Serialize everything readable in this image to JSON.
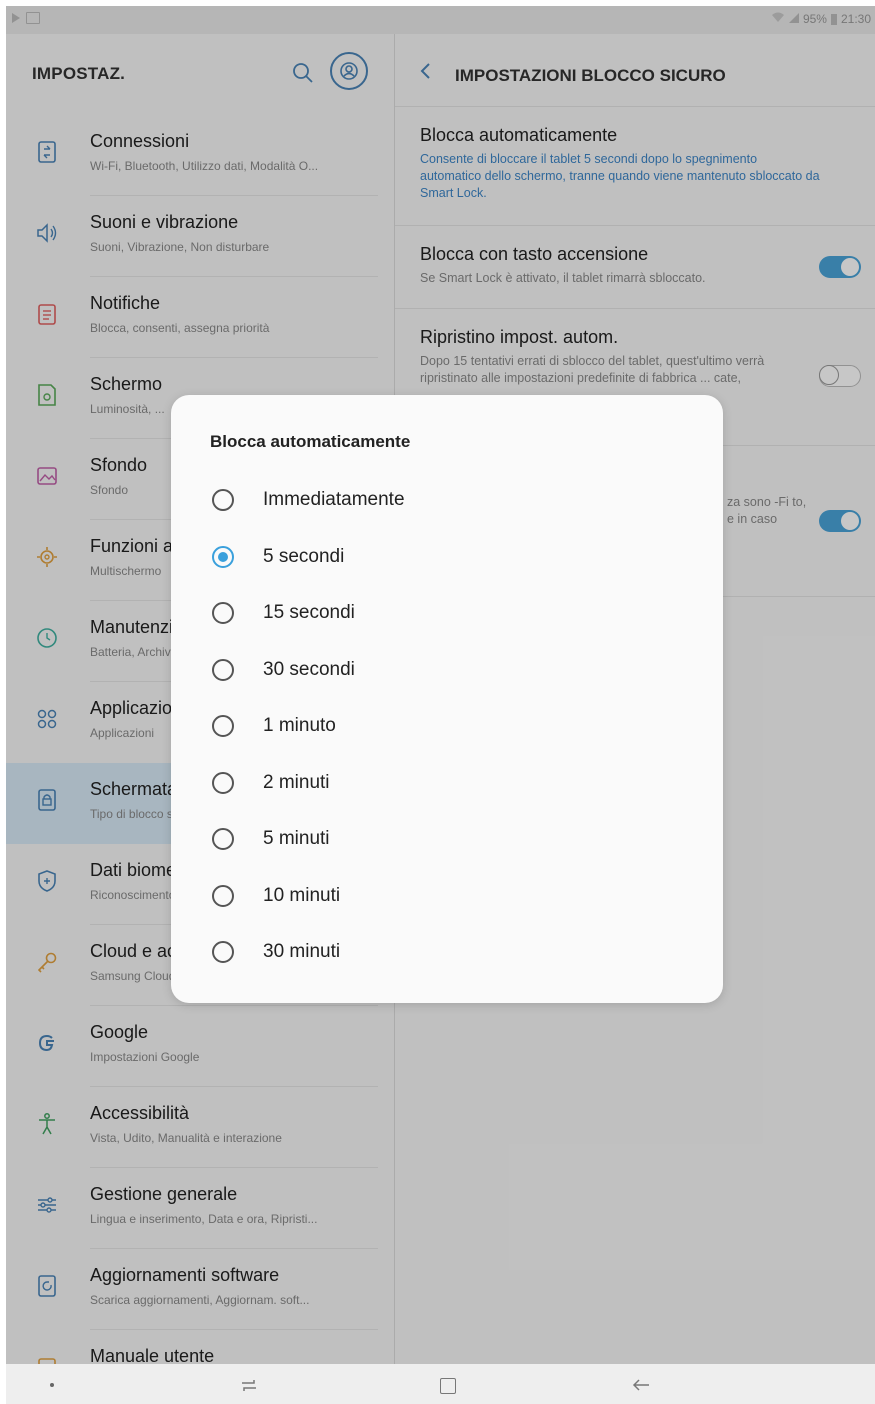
{
  "status_bar": {
    "battery": "95%",
    "time": "21:30"
  },
  "left_panel": {
    "title": "IMPOSTAZ.",
    "items": [
      {
        "icon": "connections-icon",
        "title": "Connessioni",
        "subtitle": "Wi-Fi, Bluetooth, Utilizzo dati, Modalità O..."
      },
      {
        "icon": "sound-icon",
        "title": "Suoni e vibrazione",
        "subtitle": "Suoni, Vibrazione, Non disturbare"
      },
      {
        "icon": "notifications-icon",
        "title": "Notifiche",
        "subtitle": "Blocca, consenti, assegna priorità"
      },
      {
        "icon": "display-icon",
        "title": "Schermo",
        "subtitle": "Luminosità, ..."
      },
      {
        "icon": "wallpaper-icon",
        "title": "Sfondo",
        "subtitle": "Sfondo"
      },
      {
        "icon": "advanced-features-icon",
        "title": "Funzioni avanzate",
        "subtitle": "Multischermo"
      },
      {
        "icon": "maintenance-icon",
        "title": "Manutenzione dispositivo",
        "subtitle": "Batteria, Archiviazione"
      },
      {
        "icon": "apps-icon",
        "title": "Applicazioni",
        "subtitle": "Applicazioni"
      },
      {
        "icon": "lock-screen-icon",
        "title": "Schermata di blocco",
        "subtitle": "Tipo di blocco schermo"
      },
      {
        "icon": "biometrics-icon",
        "title": "Dati biometrici e sicurezza",
        "subtitle": "Riconoscimento"
      },
      {
        "icon": "key-icon",
        "title": "Cloud e account",
        "subtitle": "Samsung Cloud"
      },
      {
        "icon": "google-icon",
        "title": "Google",
        "subtitle": "Impostazioni Google"
      },
      {
        "icon": "accessibility-icon",
        "title": "Accessibilità",
        "subtitle": "Vista, Udito, Manualità e interazione"
      },
      {
        "icon": "general-management-icon",
        "title": "Gestione generale",
        "subtitle": "Lingua e inserimento, Data e ora, Ripristi..."
      },
      {
        "icon": "software-update-icon",
        "title": "Aggiornamenti software",
        "subtitle": "Scarica aggiornamenti, Aggiornam. soft..."
      },
      {
        "icon": "user-manual-icon",
        "title": "Manuale utente",
        "subtitle": ""
      }
    ]
  },
  "right_panel": {
    "title": "IMPOSTAZIONI BLOCCO SICURO",
    "settings": [
      {
        "title": "Blocca automaticamente",
        "description": "Consente di bloccare il tablet 5 secondi dopo lo spegnimento automatico dello schermo, tranne quando viene mantenuto sbloccato da Smart Lock."
      },
      {
        "title": "Blocca con tasto accensione",
        "description": "Se Smart Lock è attivato, il tablet rimarrà sbloccato.",
        "toggle": "on"
      },
      {
        "title": "Ripristino impost. autom.",
        "description": "Dopo 15 tentativi errati di sblocco del tablet, quest'ultimo verrà ripristinato alle impostazioni predefinite di fabbrica ... cate,",
        "toggle": "off"
      },
      {
        "title": "",
        "description": "za sono -Fi to, e in caso",
        "toggle": "on"
      }
    ]
  },
  "dialog": {
    "title": "Blocca automaticamente",
    "options": [
      {
        "label": "Immediatamente",
        "checked": false
      },
      {
        "label": "5 secondi",
        "checked": true
      },
      {
        "label": "15 secondi",
        "checked": false
      },
      {
        "label": "30 secondi",
        "checked": false
      },
      {
        "label": "1 minuto",
        "checked": false
      },
      {
        "label": "2 minuti",
        "checked": false
      },
      {
        "label": "5 minuti",
        "checked": false
      },
      {
        "label": "10 minuti",
        "checked": false
      },
      {
        "label": "30 minuti",
        "checked": false
      }
    ]
  },
  "colors": {
    "accent": "#3aa0dc",
    "link": "#3d85c6",
    "selected_row": "#d8eaf7"
  }
}
